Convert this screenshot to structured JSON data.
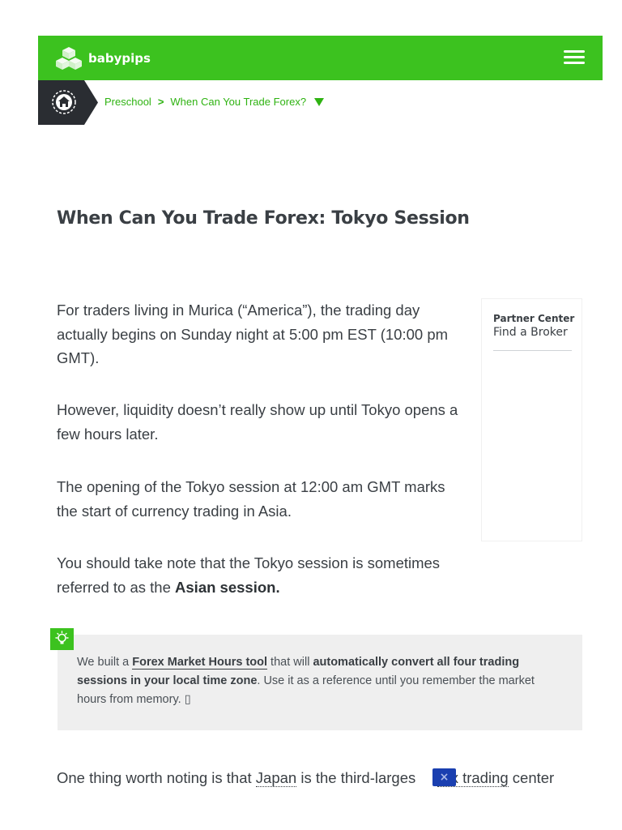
{
  "header": {
    "brand": "babypips",
    "menu_icon": "hamburger-menu-icon",
    "accent_color": "#3cc21f"
  },
  "breadcrumb": {
    "home_icon": "home-icon",
    "items": [
      "Preschool",
      "When Can You Trade Forex?"
    ],
    "separator": ">"
  },
  "article": {
    "title": "When Can You Trade Forex: Tokyo Session",
    "p1": "For traders living in Murica (“America”), the trading day actually begins on Sunday night at 5:00 pm EST (10:00 pm GMT).",
    "p2": "However, liquidity doesn’t really show up until Tokyo opens a few hours later.",
    "p3": "The opening of the Tokyo session at 12:00 am GMT marks the start of currency trading in Asia.",
    "p4_prefix": "You should take note that the Tokyo session is sometimes referred to as the ",
    "p4_bold": "Asian session.",
    "p5_prefix": "One thing worth noting is that ",
    "p5_link1": "Japan",
    "p5_mid": " is the third-larges",
    "p5_link2": "rex trading",
    "p5_suffix": " center"
  },
  "partner": {
    "label": "Partner Center",
    "title": "Find a Broker"
  },
  "tip": {
    "icon": "lightbulb-icon",
    "t1": "We built a ",
    "link": "Forex Market Hours tool",
    "t2": " that will ",
    "bold": "automatically convert all four trading sessions in your local time zone",
    "t3": ". Use it as a reference until you remember the market hours from memory. ",
    "emoji": "▯"
  },
  "ad": {
    "close_label": "×"
  }
}
